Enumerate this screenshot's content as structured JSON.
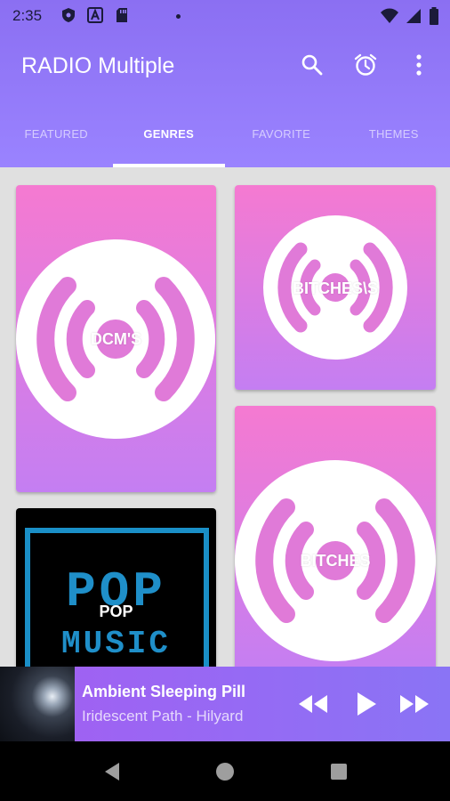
{
  "status_bar": {
    "time": "2:35",
    "left_icons": [
      "shield-icon",
      "a-badge-icon",
      "sd-card-icon"
    ],
    "right_icons": [
      "wifi-icon",
      "signal-icon",
      "battery-icon"
    ]
  },
  "app": {
    "title": "RADIO Multiple"
  },
  "toolbar": {
    "icons": [
      "search-icon",
      "alarm-icon",
      "more-vert-icon"
    ]
  },
  "tabs": [
    {
      "label": "FEATURED",
      "active": false
    },
    {
      "label": "GENRES",
      "active": true
    },
    {
      "label": "FAVORITE",
      "active": false
    },
    {
      "label": "THEMES",
      "active": false
    }
  ],
  "genres": {
    "cards": [
      {
        "label": "DCM'S"
      },
      {
        "label": "BITCHES\\S"
      },
      {
        "label": "BITCHES"
      },
      {
        "label": "POP",
        "art_text_top": "POP",
        "art_text_bottom": "MUSIC"
      }
    ]
  },
  "player": {
    "title": "Ambient Sleeping Pill",
    "artist": "Iridescent Path - Hilyard",
    "controls": [
      "rewind-icon",
      "play-icon",
      "fast-forward-icon"
    ]
  },
  "colors": {
    "header": "#8b6ff2",
    "card_top": "#f57ad1",
    "card_bottom": "#c47ef2",
    "player": "#a35ef2",
    "pop_frame": "#1a8fc7"
  }
}
